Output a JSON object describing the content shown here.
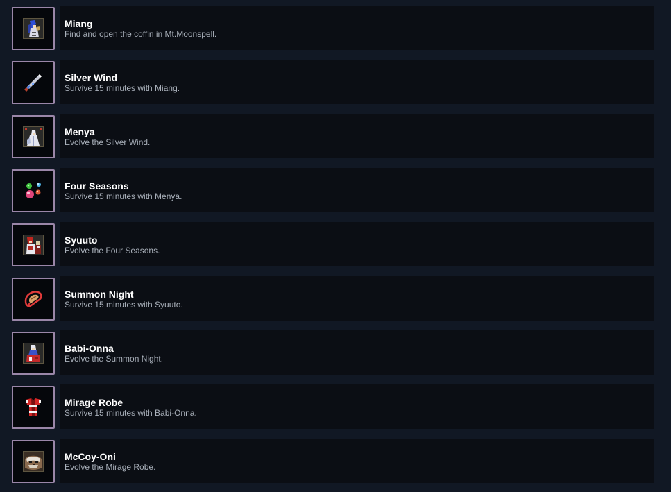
{
  "achievements": [
    {
      "title": "Miang",
      "description": "Find and open the coffin in Mt.Moonspell.",
      "icon": "miang-portrait-icon"
    },
    {
      "title": "Silver Wind",
      "description": "Survive 15 minutes with Miang.",
      "icon": "silver-wind-sword-icon"
    },
    {
      "title": "Menya",
      "description": "Evolve the Silver Wind.",
      "icon": "menya-portrait-icon"
    },
    {
      "title": "Four Seasons",
      "description": "Survive 15 minutes with Menya.",
      "icon": "four-seasons-orbs-icon"
    },
    {
      "title": "Syuuto",
      "description": "Evolve the Four Seasons.",
      "icon": "syuuto-portrait-icon"
    },
    {
      "title": "Summon Night",
      "description": "Survive 15 minutes with Syuuto.",
      "icon": "summon-night-icon"
    },
    {
      "title": "Babi-Onna",
      "description": "Evolve the Summon Night.",
      "icon": "babi-onna-portrait-icon"
    },
    {
      "title": "Mirage Robe",
      "description": "Survive 15 minutes with Babi-Onna.",
      "icon": "mirage-robe-icon"
    },
    {
      "title": "McCoy-Oni",
      "description": "Evolve the Mirage Robe.",
      "icon": "mccoy-oni-portrait-icon"
    }
  ]
}
